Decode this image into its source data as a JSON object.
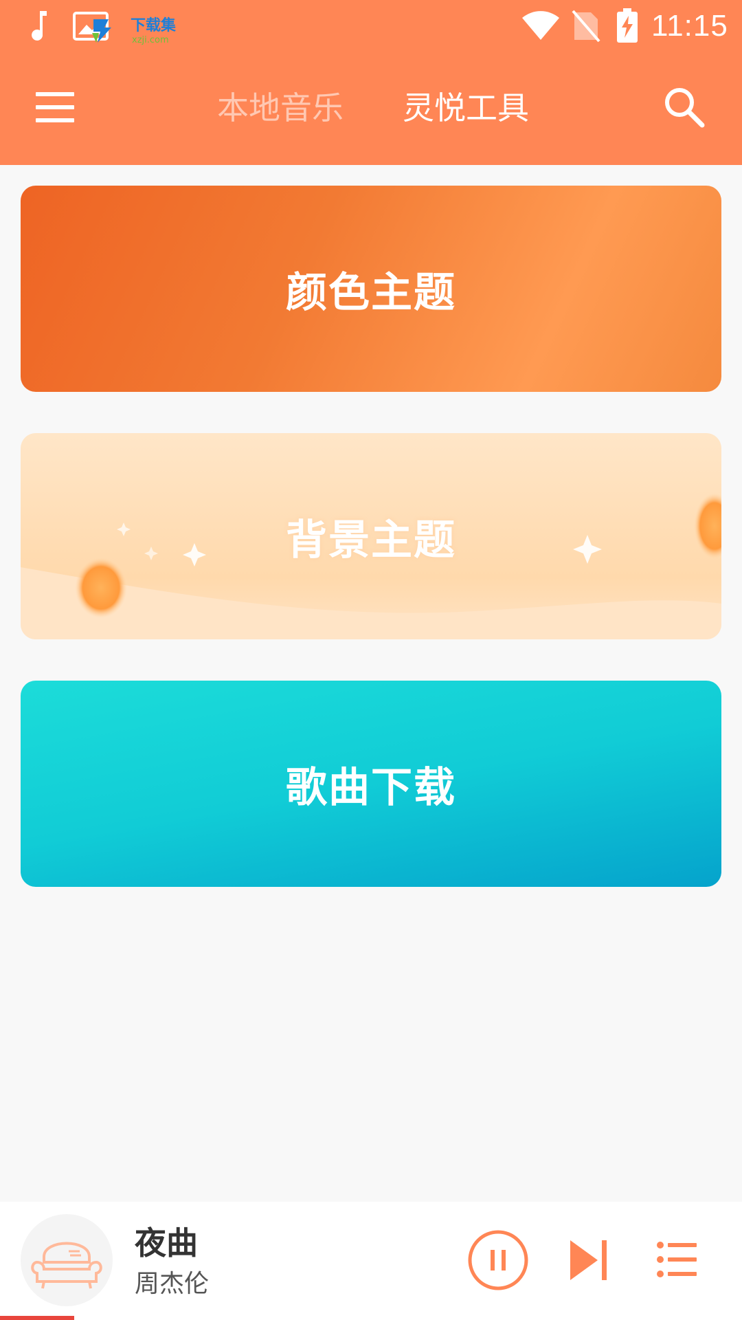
{
  "status_bar": {
    "time": "11:15",
    "icons": [
      "music-note-icon",
      "gallery-icon",
      "wifi-icon",
      "no-sim-icon",
      "battery-charging-icon"
    ],
    "watermark_text": "下载集",
    "watermark_sub": "xzji.com"
  },
  "toolbar": {
    "menu_icon": "hamburger-menu-icon",
    "tabs": [
      {
        "label": "本地音乐",
        "active": false
      },
      {
        "label": "灵悦工具",
        "active": true
      }
    ],
    "search_icon": "search-icon"
  },
  "cards": [
    {
      "label": "颜色主题"
    },
    {
      "label": "背景主题"
    },
    {
      "label": "歌曲下载"
    }
  ],
  "player": {
    "cover_icon": "sofa-placeholder-icon",
    "title": "夜曲",
    "artist": "周杰伦",
    "controls": [
      "pause-icon",
      "skip-next-icon",
      "playlist-icon"
    ],
    "progress": 0.1
  },
  "colors": {
    "accent": "#ff8655",
    "card_color_theme": "#f27a33",
    "card_background_theme": "#ffd9ac",
    "card_download": "#11ccd6",
    "progress": "#e8453c"
  }
}
